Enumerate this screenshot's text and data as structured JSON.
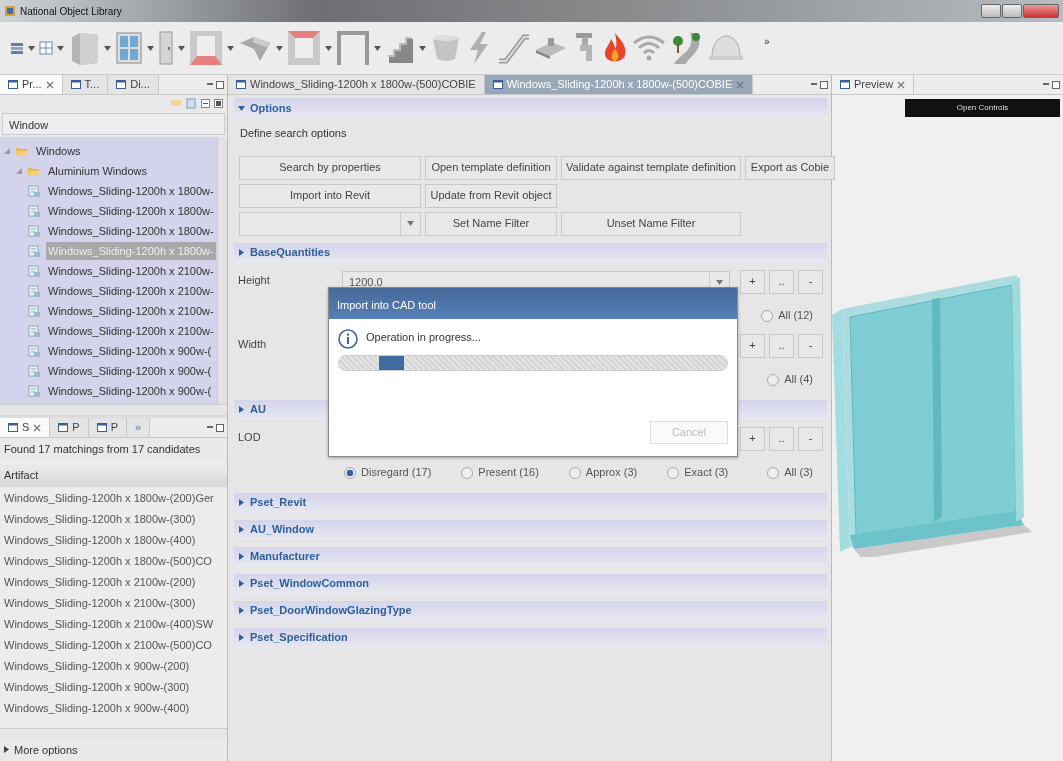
{
  "window": {
    "title": "National Object Library"
  },
  "toolbar": {
    "overflow": "»"
  },
  "left_top": {
    "tabs": [
      {
        "label": "Pr...",
        "selected": true
      },
      {
        "label": "T...",
        "selected": false
      },
      {
        "label": "Di...",
        "selected": false
      }
    ],
    "filter": {
      "value": "Window"
    },
    "tree": [
      {
        "label": "Windows",
        "kind": "folder",
        "expanded": true,
        "selected": false,
        "children": [
          {
            "label": "Aluminium Windows",
            "kind": "folder",
            "expanded": true,
            "selected": false,
            "children": [
              {
                "label": "Windows_Sliding-1200h x 1800w-",
                "kind": "item",
                "selected": false
              },
              {
                "label": "Windows_Sliding-1200h x 1800w-",
                "kind": "item",
                "selected": false
              },
              {
                "label": "Windows_Sliding-1200h x 1800w-",
                "kind": "item",
                "selected": false
              },
              {
                "label": "Windows_Sliding-1200h x 1800w-",
                "kind": "item",
                "selected": true
              },
              {
                "label": "Windows_Sliding-1200h x 2100w-",
                "kind": "item",
                "selected": false
              },
              {
                "label": "Windows_Sliding-1200h x 2100w-",
                "kind": "item",
                "selected": false
              },
              {
                "label": "Windows_Sliding-1200h x 2100w-",
                "kind": "item",
                "selected": false
              },
              {
                "label": "Windows_Sliding-1200h x 2100w-",
                "kind": "item",
                "selected": false
              },
              {
                "label": "Windows_Sliding-1200h x 900w-(",
                "kind": "item",
                "selected": false
              },
              {
                "label": "Windows_Sliding-1200h x 900w-(",
                "kind": "item",
                "selected": false
              },
              {
                "label": "Windows_Sliding-1200h x 900w-(",
                "kind": "item",
                "selected": false
              }
            ]
          }
        ]
      }
    ]
  },
  "left_bottom": {
    "tabs": [
      {
        "label": "S",
        "selected": true
      },
      {
        "label": "P",
        "selected": false
      },
      {
        "label": "P",
        "selected": false
      }
    ],
    "overflow": "»",
    "status": "Found 17 matchings from 17 candidates",
    "column": "Artifact",
    "rows": [
      "Windows_Sliding-1200h x 1800w-(200)Ger",
      "Windows_Sliding-1200h x 1800w-(300)",
      "Windows_Sliding-1200h x 1800w-(400)",
      "Windows_Sliding-1200h x 1800w-(500)CO",
      "Windows_Sliding-1200h x 2100w-(200)",
      "Windows_Sliding-1200h x 2100w-(300)",
      "Windows_Sliding-1200h x 2100w-(400)SW",
      "Windows_Sliding-1200h x 2100w-(500)CO",
      "Windows_Sliding-1200h x 900w-(200)",
      "Windows_Sliding-1200h x 900w-(300)",
      "Windows_Sliding-1200h x 900w-(400)"
    ],
    "more_options": "More options"
  },
  "editor": {
    "tabs": [
      {
        "label": "Windows_Sliding-1200h x 1800w-(500)COBIE",
        "selected": false
      },
      {
        "label": "Windows_Sliding-1200h x 1800w-(500)COBIE",
        "selected": true
      }
    ],
    "options": {
      "title": "Options",
      "expanded": true,
      "description": "Define search options",
      "buttons": [
        {
          "label": "Search by properties",
          "kind": "button"
        },
        {
          "label": "Open template definition",
          "kind": "button"
        },
        {
          "label": "Validate against template definition",
          "kind": "button"
        },
        {
          "label": "Export as Cobie",
          "kind": "button"
        },
        {
          "label": "Import into Revit",
          "kind": "button"
        },
        {
          "label": "Update from Revit object",
          "kind": "button"
        },
        {
          "kind": "gap"
        },
        {
          "kind": "gap"
        },
        {
          "kind": "combo"
        },
        {
          "label": "Set Name Filter",
          "kind": "button"
        },
        {
          "label": "Unset Name Filter",
          "kind": "button"
        }
      ]
    },
    "sections": [
      {
        "title": "BaseQuantities",
        "expanded": false,
        "properties": [
          {
            "label": "Height",
            "value": "1200.0",
            "buttons": [
              "+",
              "..",
              "-"
            ],
            "options": [
              {
                "label": "All (12)",
                "selected": false
              }
            ]
          },
          {
            "label": "Width",
            "buttons": [
              "+",
              "..",
              "-"
            ],
            "options": [
              {
                "label": "All (4)",
                "selected": false
              }
            ]
          }
        ]
      },
      {
        "title": "AU",
        "expanded": false,
        "properties": [
          {
            "label": "LOD",
            "buttons": [
              "+",
              "..",
              "-"
            ],
            "options": [
              {
                "label": "Disregard (17)",
                "selected": true
              },
              {
                "label": "Present (16)",
                "selected": false
              },
              {
                "label": "Approx (3)",
                "selected": false
              },
              {
                "label": "Exact (3)",
                "selected": false
              },
              {
                "label": "All (3)",
                "selected": false
              }
            ]
          }
        ]
      },
      {
        "title": "Pset_Revit",
        "expanded": false
      },
      {
        "title": "AU_Window",
        "expanded": false
      },
      {
        "title": "Manufacturer",
        "expanded": false
      },
      {
        "title": "Pset_WindowCommon",
        "expanded": false
      },
      {
        "title": "Pset_DoorWindowGlazingType",
        "expanded": false
      },
      {
        "title": "Pset_Specification",
        "expanded": false
      }
    ]
  },
  "preview": {
    "tab": "Preview",
    "button": "Open Controls"
  },
  "dialog": {
    "title": "Import into CAD tool",
    "message": "Operation in progress...",
    "indeterminate": true,
    "cancel": {
      "label": "Cancel",
      "disabled": true
    }
  }
}
